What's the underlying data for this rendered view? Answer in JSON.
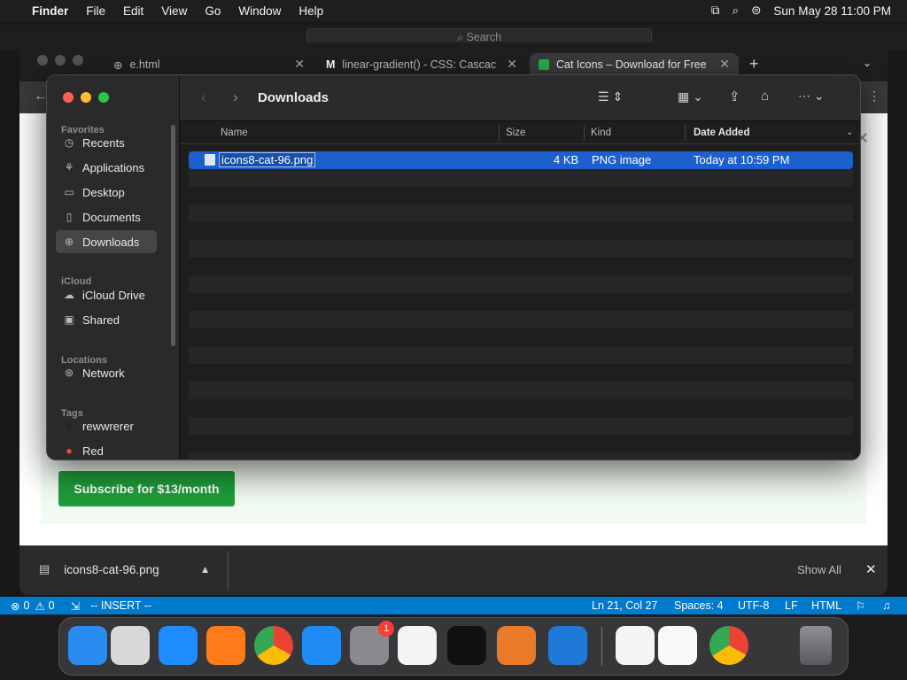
{
  "menubar": {
    "app": "Finder",
    "items": [
      "File",
      "Edit",
      "View",
      "Go",
      "Window",
      "Help"
    ],
    "datetime": "Sun May 28  11:00 PM"
  },
  "vscode_search": "Search",
  "browser": {
    "tabs": [
      {
        "label": "e.html"
      },
      {
        "label": "linear-gradient() - CSS: Cascac"
      },
      {
        "label": "Cat Icons – Download for Free"
      }
    ],
    "subscribe_label": "Subscribe for $13/month",
    "download": {
      "file": "icons8-cat-96.png",
      "show_all": "Show All"
    }
  },
  "finder": {
    "title": "Downloads",
    "sidebar": {
      "sections": [
        {
          "header": "Favorites",
          "items": [
            {
              "label": "Recents",
              "icon": "clock-icon",
              "glyph": "◷"
            },
            {
              "label": "Applications",
              "icon": "applications-icon",
              "glyph": "⚘"
            },
            {
              "label": "Desktop",
              "icon": "desktop-icon",
              "glyph": "▭"
            },
            {
              "label": "Documents",
              "icon": "document-icon",
              "glyph": "▯"
            },
            {
              "label": "Downloads",
              "icon": "download-icon",
              "glyph": "⊕"
            }
          ]
        },
        {
          "header": "iCloud",
          "items": [
            {
              "label": "iCloud Drive",
              "icon": "cloud-icon",
              "glyph": "☁"
            },
            {
              "label": "Shared",
              "icon": "shared-folder-icon",
              "glyph": "▣"
            }
          ]
        },
        {
          "header": "Locations",
          "items": [
            {
              "label": "Network",
              "icon": "globe-icon",
              "glyph": "⊛"
            }
          ]
        },
        {
          "header": "Tags",
          "items": [
            {
              "label": "rewwrerer",
              "icon": "tag-dot-icon",
              "glyph": "●"
            },
            {
              "label": "Red",
              "icon": "tag-dot-icon",
              "glyph": "●"
            }
          ]
        }
      ]
    },
    "columns": {
      "name": "Name",
      "size": "Size",
      "kind": "Kind",
      "date": "Date Added"
    },
    "files": [
      {
        "name": "icons8-cat-96.png",
        "size": "4 KB",
        "kind": "PNG image",
        "date": "Today at 10:59 PM"
      }
    ]
  },
  "statusbar": {
    "errors": "0",
    "warnings": "0",
    "mode": "-- INSERT --",
    "position": "Ln 21, Col 27",
    "spaces": "Spaces: 4",
    "encoding": "UTF-8",
    "eol": "LF",
    "language": "HTML"
  },
  "dock": {
    "apps": [
      {
        "name": "finder",
        "color": "#2a8cf0"
      },
      {
        "name": "launchpad",
        "color": "#d8d8d8"
      },
      {
        "name": "safari",
        "color": "#1e8cff"
      },
      {
        "name": "firefox",
        "color": "#ff7a1a"
      },
      {
        "name": "chrome",
        "color": "#f0f0f0"
      },
      {
        "name": "app-store",
        "color": "#1f8bf5"
      },
      {
        "name": "system-settings",
        "color": "#8a8a8e",
        "badge": "1"
      },
      {
        "name": "textedit",
        "color": "#f4f4f4"
      },
      {
        "name": "terminal",
        "color": "#111111"
      },
      {
        "name": "garageband",
        "color": "#e87a2a"
      },
      {
        "name": "vscode",
        "color": "#1e7ad6"
      },
      {
        "name": "visual-studio",
        "color": "#f4f4f4"
      },
      {
        "name": "freeform",
        "color": "#f8f8f8"
      },
      {
        "name": "chrome",
        "color": "#f0f0f0"
      },
      {
        "name": "trash",
        "color": "#6c6c70"
      }
    ]
  }
}
